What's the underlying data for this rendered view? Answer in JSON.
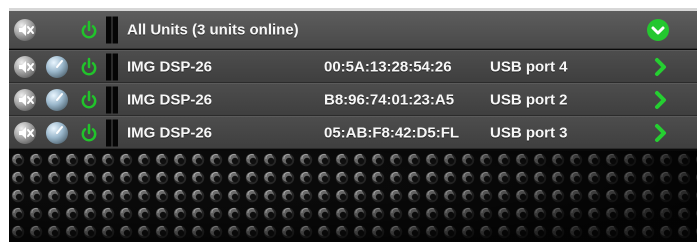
{
  "all_units": {
    "label": "All Units (3 units online)",
    "icons": {
      "mute": "speaker-mute-icon",
      "power": "power-icon",
      "meter": "level-meter-icon",
      "expand": "chevron-down-icon"
    }
  },
  "units": [
    {
      "name": "IMG DSP-26",
      "mac": "00:5A:13:28:54:26",
      "connection": "USB port 4"
    },
    {
      "name": "IMG DSP-26",
      "mac": "B8:96:74:01:23:A5",
      "connection": "USB port 2"
    },
    {
      "name": "IMG DSP-26",
      "mac": "05:AB:F8:42:D5:FL",
      "connection": "USB port 3"
    }
  ],
  "colors": {
    "accent_green": "#22b82a",
    "row_gray": "#444444",
    "header_gray": "#555555",
    "text": "#f7f7f7"
  }
}
